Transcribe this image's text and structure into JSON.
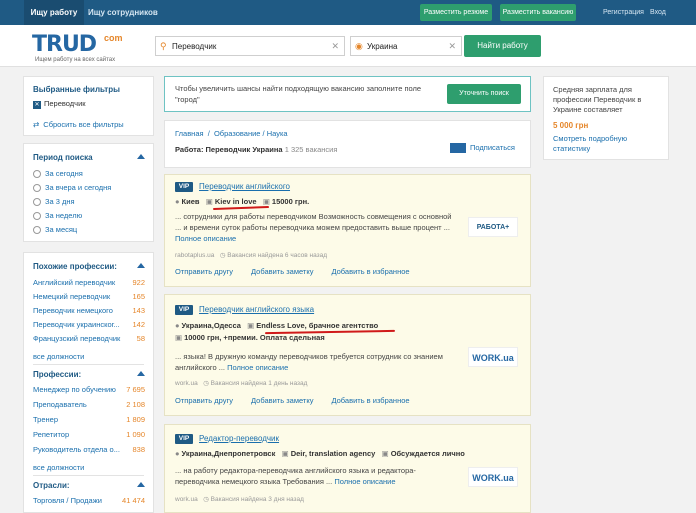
{
  "topbar": {
    "tab_active": "Ищу работу",
    "tab_other": "Ищу сотрудников",
    "btn_resume": "Разместить резюме",
    "btn_vacancy": "Разместить вакансию",
    "link_register": "Регистрация",
    "link_login": "Вход"
  },
  "header": {
    "logo_word": "TRUD",
    "logo_com": "com",
    "logo_tagline": "Ищем работу на всех сайтах",
    "query": "Переводчик",
    "location": "Украина",
    "find_button": "Найти работу"
  },
  "filters": {
    "title": "Выбранные фильтры",
    "selected": "Переводчик",
    "reset": "Сбросить все фильтры"
  },
  "period": {
    "title": "Период поиска",
    "options": [
      "За сегодня",
      "За вчера и сегодня",
      "За 3 дня",
      "За неделю",
      "За месяц"
    ]
  },
  "similar": {
    "title": "Похожие профессии:",
    "items": [
      {
        "label": "Английский переводчик",
        "count": "922"
      },
      {
        "label": "Немецкий переводчик",
        "count": "165"
      },
      {
        "label": "Переводчик немецкого",
        "count": "143"
      },
      {
        "label": "Переводчик украинског...",
        "count": "142"
      },
      {
        "label": "Французский переводчик",
        "count": "58"
      }
    ],
    "all": "все должности"
  },
  "professions": {
    "title": "Профессии:",
    "items": [
      {
        "label": "Менеджер по обучению",
        "count": "7 695"
      },
      {
        "label": "Преподаватель",
        "count": "2 108"
      },
      {
        "label": "Тренер",
        "count": "1 809"
      },
      {
        "label": "Репетитор",
        "count": "1 090"
      },
      {
        "label": "Руководитель отдела о...",
        "count": "838"
      }
    ],
    "all": "все должности"
  },
  "industries": {
    "title": "Отрасли:",
    "items": [
      {
        "label": "Торговля / Продажи",
        "count": "41 474"
      }
    ]
  },
  "notice": {
    "text": "Чтобы увеличить шансы найти подходящую вакансию заполните поле \"город\"",
    "button": "Уточнить поиск"
  },
  "listing": {
    "breadcrumb": "Главная  /  Образование / Наука",
    "heading": "Работа: Переводчик Украина",
    "count": "1 325 вакансия",
    "subscribe": "Подписаться"
  },
  "jobs": [
    {
      "badge": "VIP",
      "title": "Переводчик английского",
      "city": "Киев",
      "company": "Kiev in love",
      "salary": "15000 грн.",
      "desc": "... сотрудники для работы переводчиком Возможность совмещения с основной ... и времени суток работы переводчика можем предоставить выше процент ...",
      "more": "Полное описание",
      "source": "rabotaplus.ua",
      "age": "Вакансия найдена 6 часов назад",
      "logo": "РАБОТА+",
      "actions": [
        "Отправить другу",
        "Добавить заметку",
        "Добавить в избранное"
      ]
    },
    {
      "badge": "VIP",
      "title": "Переводчик английского языка",
      "city": "Украина,Одесса",
      "company": "Endless Love, брачное агентство",
      "salary": "10000 грн, +премии. Оплата сдельная",
      "desc": "... языка! В дружную команду переводчиков требуется сотрудник со знанием английского ...",
      "more": "Полное описание",
      "source": "work.ua",
      "age": "Вакансия найдена 1 день назад",
      "logo": "WORK.ua",
      "actions": [
        "Отправить другу",
        "Добавить заметку",
        "Добавить в избранное"
      ]
    },
    {
      "badge": "VIP",
      "title": "Редактор-переводчик",
      "city": "Украина,Днепропетровск",
      "company": "Deir, translation agency",
      "salary": "Обсуждается лично",
      "desc": "... на работу редактора-переводчика английского языка и редактора-переводчика немецкого языка Требования ...",
      "more": "Полное описание",
      "source": "work.ua",
      "age": "Вакансия найдена 3 дня назад",
      "logo": "WORK.ua"
    }
  ],
  "salary": {
    "text": "Средняя зарплата для профессии Переводчик в Украине составляет",
    "value": "5 000 грн",
    "link": "Смотреть подробную статистику"
  }
}
